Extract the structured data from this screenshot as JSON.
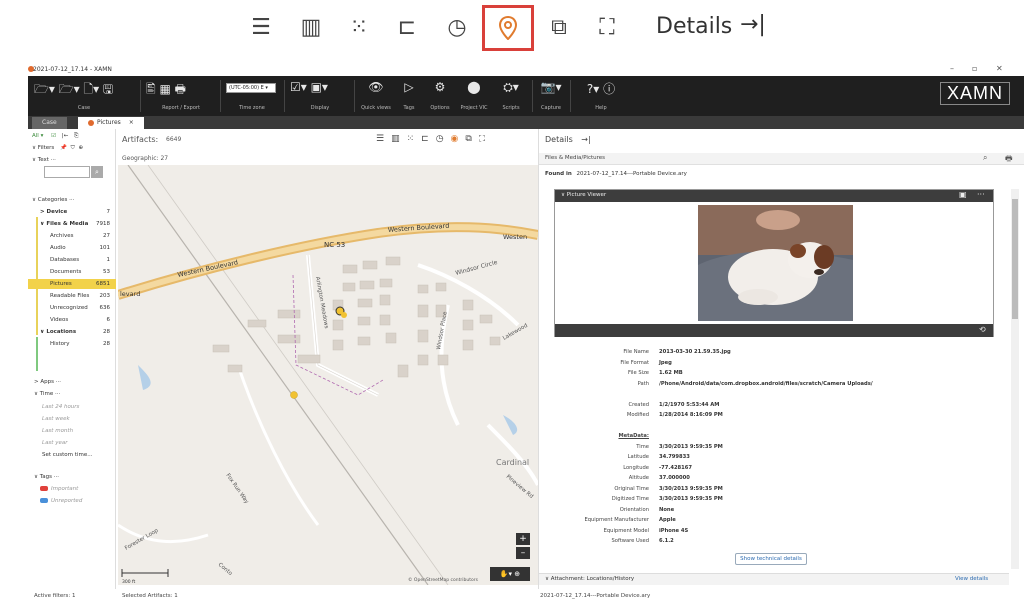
{
  "big_toolbar": {
    "icons": [
      "list-view-icon",
      "columns-view-icon",
      "grid-view-icon",
      "timeline-icon",
      "clock-icon",
      "map-pin-icon",
      "chat-icon",
      "graph-icon"
    ],
    "active": "map-pin-icon",
    "details_label": "Details",
    "details_arrow": "→|"
  },
  "window": {
    "title": "2021-07-12_17.14 - XAMN",
    "min": "–",
    "max": "▫",
    "close": "✕"
  },
  "ribbon": {
    "groups": [
      {
        "label": "Case",
        "icons": "🗁▾ 🗁▾ 🗋▾ 🖫"
      },
      {
        "label": "Report / Export",
        "icons": "🖺 ▦ 🖶"
      },
      {
        "label": "Time zone",
        "icons": ""
      },
      {
        "label": "Display",
        "icons": "☑▾ ▣▾"
      },
      {
        "label": "Quick views",
        "icons": "👁"
      },
      {
        "label": "Tags",
        "icons": "▷"
      },
      {
        "label": "Options",
        "icons": "⚙"
      },
      {
        "label": "Project VIC",
        "icons": "⬤"
      },
      {
        "label": "Scripts",
        "icons": "⛭▾"
      },
      {
        "label": "Capture",
        "icons": "📷▾"
      },
      {
        "label": "Help",
        "icons": "?▾ ⓘ"
      }
    ],
    "timezone": "(UTC-05:00) E ▾",
    "logo": "XAMN"
  },
  "tabs": {
    "case": "Case",
    "pictures": "Pictures",
    "close": "×"
  },
  "left_panel": {
    "all": "All ▾",
    "filters": "∨ Filters",
    "text": "∨ Text ···",
    "categories": "∨ Categories ···",
    "items": [
      {
        "label": "> Device",
        "count": "7",
        "bold": true
      },
      {
        "label": "∨ Files & Media",
        "count": "7918",
        "bold": true
      },
      {
        "label": "Archives",
        "count": "27"
      },
      {
        "label": "Audio",
        "count": "101"
      },
      {
        "label": "Databases",
        "count": "1"
      },
      {
        "label": "Documents",
        "count": "53"
      },
      {
        "label": "Pictures",
        "count": "6851",
        "highlight": true
      },
      {
        "label": "Readable Files",
        "count": "203"
      },
      {
        "label": "Unrecognized",
        "count": "636"
      },
      {
        "label": "Videos",
        "count": "6"
      },
      {
        "label": "∨ Locations",
        "count": "28",
        "bold": true
      },
      {
        "label": "History",
        "count": "28"
      }
    ],
    "apps": "> Apps ···",
    "time": "∨ Time ···",
    "time_items": [
      "Last 24 hours",
      "Last week",
      "Last month",
      "Last year"
    ],
    "custom_time": "Set custom time...",
    "tags": "∨ Tags ···",
    "tag_items": [
      {
        "label": "Important",
        "color": "#e0413b"
      },
      {
        "label": "Unreported",
        "color": "#4a90d9"
      }
    ]
  },
  "map_panel": {
    "artifacts": "Artifacts:",
    "artifacts_count": "6649",
    "geographic": "Geographic: 27",
    "labels": {
      "nc53": "NC 53",
      "western_blvd_1": "Western Boulevard",
      "western_blvd_2": "Western Boulevard",
      "western_blvd_3": "Westen",
      "blvd_left": "levard",
      "windsor_circle": "Windsor Circle",
      "windsor_place": "Windsor Place",
      "lakewood": "Lakewood",
      "cardinal": "Cardinal",
      "pineview": "Pineview Rd",
      "arlington": "Arlington Meadows",
      "fox_run": "Fox Run Way",
      "forester": "Forester Loop",
      "contour": "Conto",
      "attribution": "© OpenStreetMap contributors",
      "scale": "300 ft",
      "zoom_in": "+",
      "zoom_out": "–"
    }
  },
  "details": {
    "header": "Details",
    "arrow": "→|",
    "breadcrumb": "Files & Media/Pictures",
    "found_in_label": "Found in",
    "found_in_value": "2021-07-12_17.14---Portable Device.ary",
    "viewer_title": "∨ Picture Viewer",
    "fields": [
      {
        "k": "File Name",
        "v": "2013-03-30 21.59.35.jpg"
      },
      {
        "k": "File Format",
        "v": "Jpeg"
      },
      {
        "k": "File Size",
        "v": "1.62 MB"
      },
      {
        "k": "Path",
        "v": "/Phone/Android/data/com.dropbox.android/files/scratch/Camera Uploads/"
      },
      {
        "k": "",
        "v": ""
      },
      {
        "k": "Created",
        "v": "1/2/1970 5:53:44 AM"
      },
      {
        "k": "Modified",
        "v": "1/28/2014 8:16:09 PM"
      },
      {
        "k": "",
        "v": ""
      },
      {
        "k": "MetaData:",
        "v": ""
      },
      {
        "k": "Time",
        "v": "3/30/2013 9:59:35 PM"
      },
      {
        "k": "Latitude",
        "v": "34.799833"
      },
      {
        "k": "Longitude",
        "v": "-77.428167"
      },
      {
        "k": "Altitude",
        "v": "37.000000"
      },
      {
        "k": "Original Time",
        "v": "3/30/2013 9:59:35 PM"
      },
      {
        "k": "Digitized Time",
        "v": "3/30/2013 9:59:35 PM"
      },
      {
        "k": "Orientation",
        "v": "None"
      },
      {
        "k": "Equipment Manufacturer",
        "v": "Apple"
      },
      {
        "k": "Equipment Model",
        "v": "iPhone 4S"
      },
      {
        "k": "Software Used",
        "v": "6.1.2"
      }
    ],
    "show_technical": "Show technical details",
    "attachment": "∨ Attachment: Locations/History",
    "view_details": "View details"
  },
  "statusbar": {
    "active_filters": "Active filters: 1",
    "selected": "Selected Artifacts: 1",
    "source": "2021-07-12_17.14---Portable Device.ary"
  }
}
